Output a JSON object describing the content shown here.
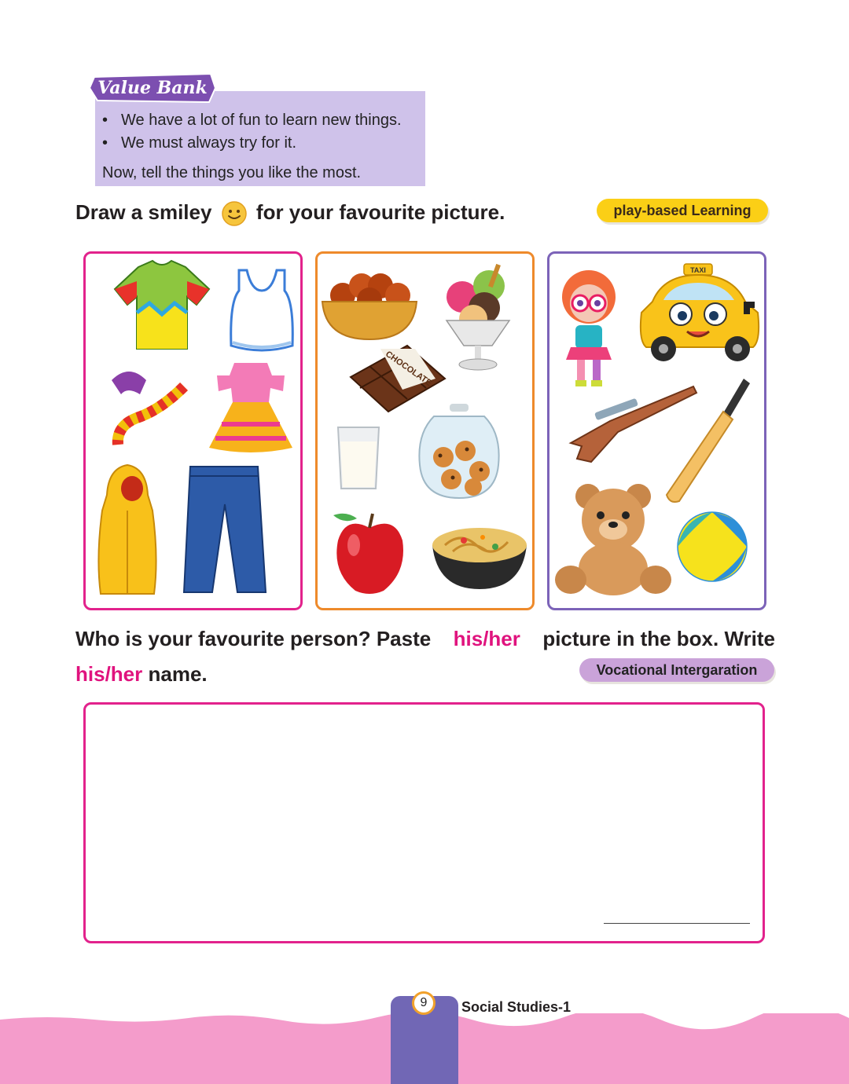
{
  "value_bank": {
    "title": "Value Bank",
    "bullets": [
      "We have a lot of fun to learn new things.",
      "We must always try for it."
    ],
    "prompt": "Now, tell the things you like the most."
  },
  "activity1": {
    "text_before": "Draw a smiley",
    "text_after": "for your favourite picture.",
    "tag": "play-based Learning",
    "panels": [
      {
        "items": [
          "t-shirt",
          "vest",
          "scarf",
          "frock",
          "raincoat",
          "jeans"
        ]
      },
      {
        "items": [
          "gulab-jamun-bowl",
          "ice-cream-cup",
          "chocolate-bar",
          "glass-of-milk",
          "cookie-jar",
          "apple",
          "noodles-bowl"
        ],
        "chocolate_label": "CHOCOLATE"
      },
      {
        "items": [
          "doll",
          "taxi-car",
          "toy-gun",
          "cricket-bat",
          "teddy-bear",
          "beach-ball"
        ],
        "taxi_label": "TAXI"
      }
    ]
  },
  "activity2": {
    "part1": "Who is your favourite person? Paste",
    "highlight1": "his/her",
    "part2": "picture in the box. Write",
    "highlight2": "his/her",
    "part3": "name.",
    "tag": "Vocational Intergaration"
  },
  "footer": {
    "page_number": "9",
    "book_title": "Social Studies-1"
  },
  "colors": {
    "pink_accent": "#e0137e",
    "value_bank_bg": "#cfc2ea",
    "play_tag": "#fbcf16",
    "vocational_tag": "#caa3d9",
    "footer_band": "#f49ccb",
    "page_tab": "#7167b5"
  }
}
